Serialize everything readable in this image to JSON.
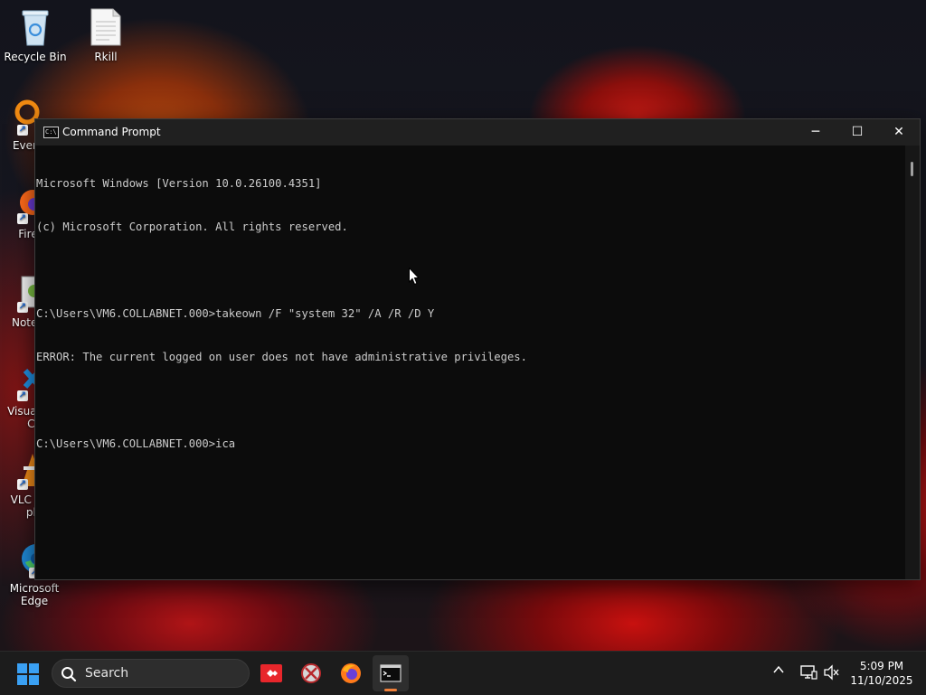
{
  "desktop": {
    "icons": [
      {
        "label": "Recycle Bin"
      },
      {
        "label": "Rkill"
      },
      {
        "label": "Every"
      },
      {
        "label": "Fire"
      },
      {
        "label": "Notep"
      },
      {
        "label": "Visual",
        "label2": "Co"
      },
      {
        "label": "VLC n",
        "label2": "pla"
      },
      {
        "label": "Microsoft",
        "label2": "Edge"
      }
    ]
  },
  "window": {
    "title": "Command Prompt",
    "icon_text": "C:\\",
    "minimize_glyph": "─",
    "maximize_glyph": "☐",
    "close_glyph": "✕"
  },
  "console": {
    "lines": [
      "Microsoft Windows [Version 10.0.26100.4351]",
      "(c) Microsoft Corporation. All rights reserved.",
      "",
      "C:\\Users\\VM6.COLLABNET.000>takeown /F \"system 32\" /A /R /D Y",
      "ERROR: The current logged on user does not have administrative privileges.",
      "",
      "C:\\Users\\VM6.COLLABNET.000>ica"
    ]
  },
  "taskbar": {
    "search_label": "Search",
    "apps": [
      {
        "name": "anydesk-icon"
      },
      {
        "name": "rkill-icon"
      },
      {
        "name": "firefox-icon"
      },
      {
        "name": "command-prompt-icon"
      }
    ],
    "tray": {
      "chevron": "^"
    },
    "clock": {
      "time": "5:09 PM",
      "date": "11/10/2025"
    }
  },
  "colors": {
    "console_bg": "#0c0c0c",
    "console_fg": "#cccccc",
    "titlebar_bg": "#202020",
    "taskbar_bg": "#1c1c1c",
    "accent": "#f0803a"
  }
}
